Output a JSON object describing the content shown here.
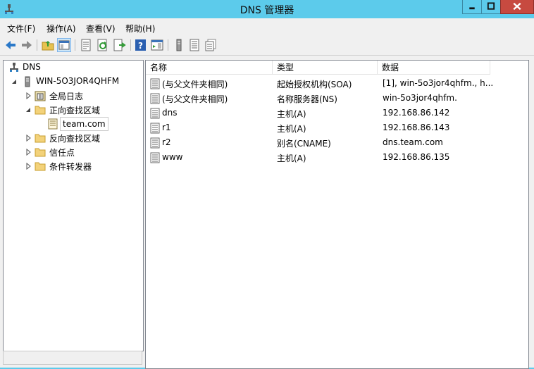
{
  "window": {
    "title": "DNS 管理器"
  },
  "menu": [
    "文件(F)",
    "操作(A)",
    "查看(V)",
    "帮助(H)"
  ],
  "toolbar": {
    "icons": [
      "back-icon",
      "forward-icon",
      "up-folder-icon",
      "show-hide-tree-icon",
      "properties-icon",
      "refresh-icon",
      "export-icon",
      "help-icon",
      "action-pane-icon",
      "server-icon",
      "zone-icon",
      "records-icon"
    ]
  },
  "tree": {
    "root": "DNS",
    "server": "WIN-5O3JOR4QHFM",
    "items": [
      {
        "label": "全局日志"
      },
      {
        "label": "正向查找区域"
      },
      {
        "label": "team.com"
      },
      {
        "label": "反向查找区域"
      },
      {
        "label": "信任点"
      },
      {
        "label": "条件转发器"
      }
    ]
  },
  "list": {
    "columns": [
      "名称",
      "类型",
      "数据"
    ],
    "rows": [
      {
        "name": "(与父文件夹相同)",
        "type": "起始授权机构(SOA)",
        "data": "[1], win-5o3jor4qhfm., h..."
      },
      {
        "name": "(与父文件夹相同)",
        "type": "名称服务器(NS)",
        "data": "win-5o3jor4qhfm."
      },
      {
        "name": "dns",
        "type": "主机(A)",
        "data": "192.168.86.142"
      },
      {
        "name": "r1",
        "type": "主机(A)",
        "data": "192.168.86.143"
      },
      {
        "name": "r2",
        "type": "别名(CNAME)",
        "data": "dns.team.com"
      },
      {
        "name": "www",
        "type": "主机(A)",
        "data": "192.168.86.135"
      }
    ]
  },
  "colors": {
    "titlebar": "#5ccbeb",
    "close": "#c74a40",
    "selection": "#cde6f7"
  }
}
